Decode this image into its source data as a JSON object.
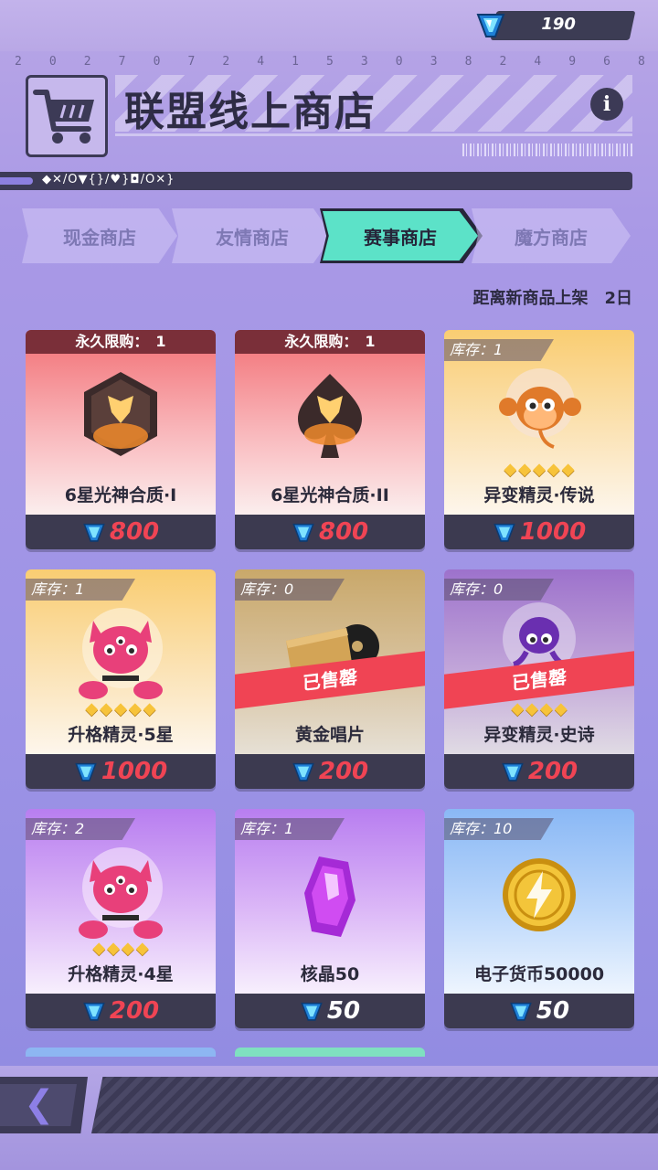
{
  "header": {
    "currency_amount": "190",
    "digits": [
      "2",
      "0",
      "2",
      "7",
      "0",
      "7",
      "2",
      "4",
      "1",
      "5",
      "3",
      "0",
      "3",
      "8",
      "2",
      "4",
      "9",
      "6",
      "8"
    ],
    "title": "联盟线上商店",
    "info_label": "i",
    "symbol_text": "◆✕/O▼{}/♥}◘/O✕}"
  },
  "tabs": [
    {
      "label": "现金商店",
      "active": false
    },
    {
      "label": "友情商店",
      "active": false
    },
    {
      "label": "赛事商店",
      "active": true
    },
    {
      "label": "魔方商店",
      "active": false
    }
  ],
  "countdown": "距离新商品上架　2日",
  "products": [
    {
      "name": "6星光神合质·I",
      "banner": "永久限购：　1",
      "price": "800",
      "price_color": "#f04454",
      "bg": "red",
      "icon": "hexagon-wing-emblem-icon"
    },
    {
      "name": "6星光神合质·II",
      "banner": "永久限购：　1",
      "price": "800",
      "price_color": "#f04454",
      "bg": "red",
      "icon": "spade-wing-emblem-icon"
    },
    {
      "name": "异变精灵·传说",
      "stock": "库存：1",
      "price": "1000",
      "price_color": "#f04454",
      "bg": "gold",
      "stars": 5,
      "icon": "monkey-spirit-icon"
    },
    {
      "name": "升格精灵·5星",
      "stock": "库存：1",
      "price": "1000",
      "price_color": "#f04454",
      "bg": "gold",
      "stars": 5,
      "icon": "pink-cat-spirit-icon"
    },
    {
      "name": "黄金唱片",
      "stock": "库存：0",
      "price": "200",
      "price_color": "#f04454",
      "bg": "gold-dim",
      "sold": "已售罄",
      "icon": "golden-record-icon"
    },
    {
      "name": "异变精灵·史诗",
      "stock": "库存：0",
      "price": "200",
      "price_color": "#f04454",
      "bg": "purple-dim",
      "sold": "已售罄",
      "stars": 4,
      "icon": "purple-spirit-icon"
    },
    {
      "name": "升格精灵·4星",
      "stock": "库存：2",
      "price": "200",
      "price_color": "#f04454",
      "bg": "purple",
      "stars": 4,
      "icon": "pink-cat-spirit-icon"
    },
    {
      "name": "核晶50",
      "stock": "库存：1",
      "price": "50",
      "price_color": "#ffffff",
      "bg": "purple",
      "icon": "purple-crystal-icon"
    },
    {
      "name": "电子货币50000",
      "stock": "库存：10",
      "price": "50",
      "price_color": "#ffffff",
      "bg": "blue",
      "icon": "gold-coin-icon"
    }
  ],
  "footer": {
    "back_label": "❮"
  },
  "colors": {
    "accent_tab": "#5ce2c8",
    "price_red": "#f04454",
    "dark": "#3c3a56"
  }
}
